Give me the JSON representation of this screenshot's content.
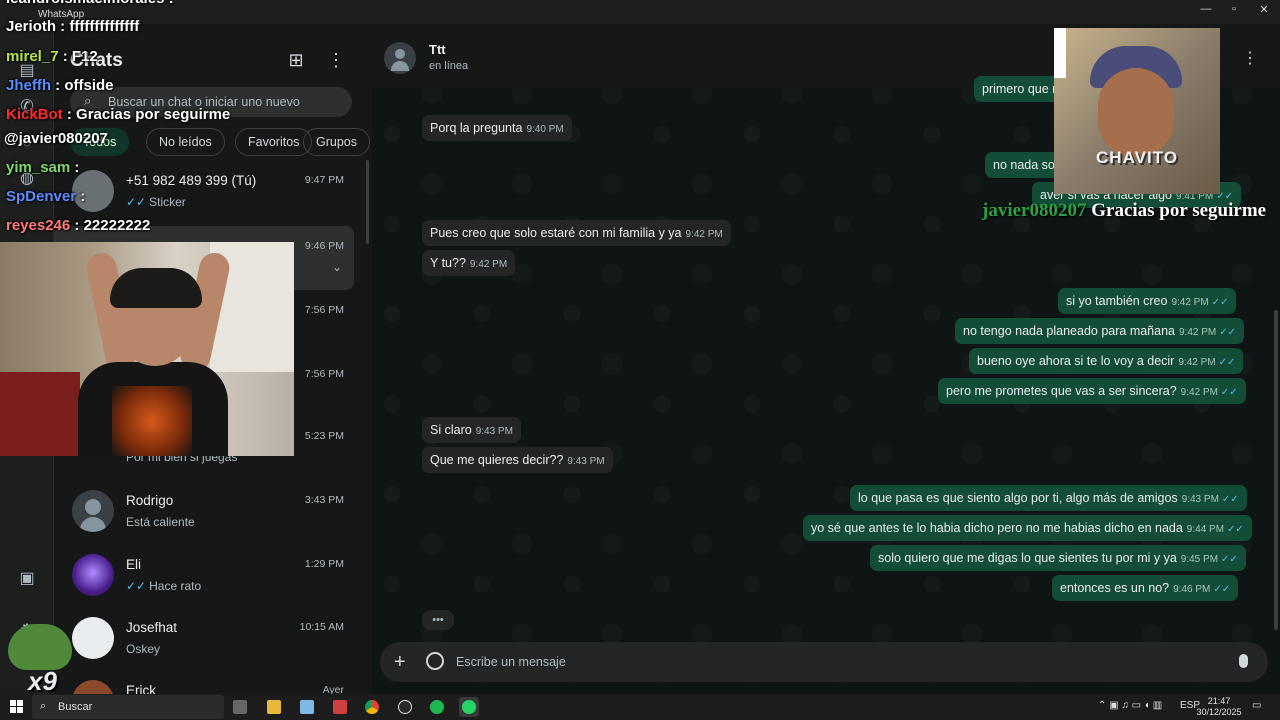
{
  "app": {
    "window_label": "WhatsApp"
  },
  "chatlist": {
    "title": "Chats",
    "search_placeholder": "Buscar un chat o iniciar uno nuevo",
    "chips": [
      "Todos",
      "No leídos",
      "Favoritos",
      "Grupos"
    ],
    "items": [
      {
        "name": "+51 982 489 399 (Tú)",
        "time": "9:47 PM",
        "preview": "Sticker"
      },
      {
        "name": "",
        "time": "9:46 PM",
        "preview": ""
      },
      {
        "name": "",
        "time": "7:56 PM",
        "preview": ""
      },
      {
        "name": "",
        "time": "7:56 PM",
        "preview": ""
      },
      {
        "name": "",
        "time": "5:23 PM",
        "preview": "Por mi bien si juegas"
      },
      {
        "name": "Rodrigo",
        "time": "3:43 PM",
        "preview": "Está caliente"
      },
      {
        "name": "Eli",
        "time": "1:29 PM",
        "preview": "Hace rato"
      },
      {
        "name": "Josefhat",
        "time": "10:15 AM",
        "preview": "Oskey"
      },
      {
        "name": "Erick",
        "time": "Ayer",
        "preview": ""
      }
    ]
  },
  "conversation": {
    "contact_name": "Ttt",
    "status": "en línea",
    "composer_placeholder": "Escribe un mensaje",
    "messages": [
      {
        "dir": "out",
        "text": "primero que n",
        "time": ""
      },
      {
        "dir": "in",
        "text": "Porq la pregunta",
        "time": "9:40 PM"
      },
      {
        "dir": "out",
        "text": "no nada so",
        "time": ""
      },
      {
        "dir": "out",
        "text": "aver si vas a hacer algo",
        "time": "9:41 PM"
      },
      {
        "dir": "in",
        "text": "Pues creo que solo estaré con mi familia y ya",
        "time": "9:42 PM"
      },
      {
        "dir": "in",
        "text": "Y tu??",
        "time": "9:42 PM"
      },
      {
        "dir": "out",
        "text": "si yo también creo",
        "time": "9:42 PM"
      },
      {
        "dir": "out",
        "text": "no tengo nada planeado para mañana",
        "time": "9:42 PM"
      },
      {
        "dir": "out",
        "text": "bueno oye ahora si te lo voy a decir",
        "time": "9:42 PM"
      },
      {
        "dir": "out",
        "text": "pero me prometes que vas a ser sincera?",
        "time": "9:42 PM"
      },
      {
        "dir": "in",
        "text": "Si claro",
        "time": "9:43 PM"
      },
      {
        "dir": "in",
        "text": "Que me quieres decir??",
        "time": "9:43 PM"
      },
      {
        "dir": "out",
        "text": "lo que pasa es que siento algo por ti, algo más de amigos",
        "time": "9:43 PM"
      },
      {
        "dir": "out",
        "text": "yo sé que antes te lo habia dicho pero no me habias dicho en nada",
        "time": "9:44 PM"
      },
      {
        "dir": "out",
        "text": "solo quiero que me digas lo que sientes tu por mi y ya",
        "time": "9:45 PM"
      },
      {
        "dir": "out",
        "text": "entonces es un no?",
        "time": "9:46 PM"
      }
    ]
  },
  "stream_overlay": {
    "chat": [
      {
        "user": "leandroismaelmorales",
        "text": ""
      },
      {
        "user": "Jerioth",
        "text": "ffffffffffffff"
      },
      {
        "user": "mirel_7",
        "text": "F12"
      },
      {
        "user": "Jheffh",
        "text": "offside"
      },
      {
        "user": "KickBot",
        "text": "Gracias por seguirme"
      },
      {
        "user": "@javier080207",
        "text": ""
      },
      {
        "user": "yim_sam",
        "text": ""
      },
      {
        "user": "SpDenver",
        "text": ""
      },
      {
        "user": "reyes246",
        "text": "22222222"
      }
    ],
    "follow_user": "javier080207",
    "follow_text": "Gracias por seguirme",
    "cam_label": "CHAVITO",
    "counter": "x9"
  },
  "taskbar": {
    "search_label": "Buscar",
    "lang": "ESP",
    "time": "21:47",
    "date": "30/12/2025"
  },
  "colors": {
    "outgoing": "#144d37",
    "incoming": "#242626",
    "accent": "#00a884",
    "read_tick": "#53bdeb"
  }
}
